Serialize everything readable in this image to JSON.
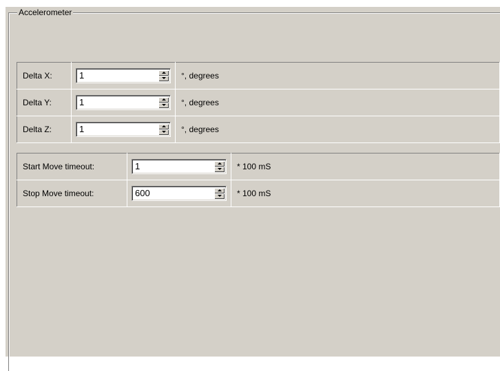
{
  "group": {
    "title": "Accelerometer"
  },
  "delta_rows": [
    {
      "label": "Delta X:",
      "value": "1",
      "unit": "°, degrees"
    },
    {
      "label": "Delta Y:",
      "value": "1",
      "unit": "°, degrees"
    },
    {
      "label": "Delta Z:",
      "value": "1",
      "unit": "°, degrees"
    }
  ],
  "timeout_rows": [
    {
      "label": "Start Move timeout:",
      "value": "1",
      "unit": "* 100 mS"
    },
    {
      "label": "Stop Move timeout:",
      "value": "600",
      "unit": "* 100 mS"
    }
  ],
  "icons": {
    "spin_up": "spin-up-arrow-icon",
    "spin_down": "spin-down-arrow-icon"
  }
}
